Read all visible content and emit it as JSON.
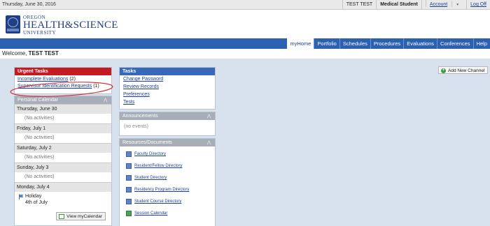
{
  "topbar": {
    "date": "Thursday, June 30, 2016",
    "user": "TEST TEST",
    "role": "Medical Student",
    "account": "Account",
    "logoff": "Log Off"
  },
  "logo": {
    "line1": "OREGON",
    "line2": "HEALTH&SCIENCE",
    "line3": "UNIVERSITY"
  },
  "nav": {
    "tabs": [
      "myHome",
      "Portfolio",
      "Schedules",
      "Procedures",
      "Evaluations",
      "Conferences",
      "Help"
    ],
    "active": "myHome"
  },
  "welcome": {
    "prefix": "Welcome,",
    "name": "TEST TEST"
  },
  "urgent": {
    "title": "Urgent Tasks",
    "items": [
      {
        "label": "Incomplete Evaluations",
        "count": "(2)"
      },
      {
        "label": "Supervisor Identification Requests",
        "count": "(1)"
      }
    ]
  },
  "calendar": {
    "title": "Personal Calendar",
    "days": [
      {
        "label": "Thursday, June 30",
        "note": "(No activities)"
      },
      {
        "label": "Friday, July 1",
        "note": "(No activities)"
      },
      {
        "label": "Saturday, July 2",
        "note": "(No activities)"
      },
      {
        "label": "Sunday, July 3",
        "note": "(No activities)"
      },
      {
        "label": "Monday, July 4"
      }
    ],
    "holiday_line1": "Holiday",
    "holiday_line2": "4th of July",
    "button": "View myCalendar"
  },
  "tasks": {
    "title": "Tasks",
    "items": [
      "Change Password",
      "Review Records",
      "Preferences",
      "Tests"
    ]
  },
  "announcements": {
    "title": "Announcements",
    "empty": "(no events)"
  },
  "resources": {
    "title": "Resources/Documents",
    "items": [
      "Faculty Directory",
      "Resident/Fellow Directory",
      "Student Directory",
      "Residency Program Directory",
      "Student Course Directory",
      "Session Calendar"
    ]
  },
  "add_channel": "Add New Channel",
  "colors": {
    "nav_blue": "#2c60b0",
    "urgent_red": "#c41a22",
    "content_bg": "#d8e2ef",
    "annotation_red": "#d0262d"
  },
  "icons": {
    "dropdown": "chevron-down-icon",
    "box_toggle": "chevron-icon",
    "holiday": "flag-icon",
    "calendar_button": "calendar-icon",
    "add": "plus-icon",
    "resource": "document-icon"
  }
}
